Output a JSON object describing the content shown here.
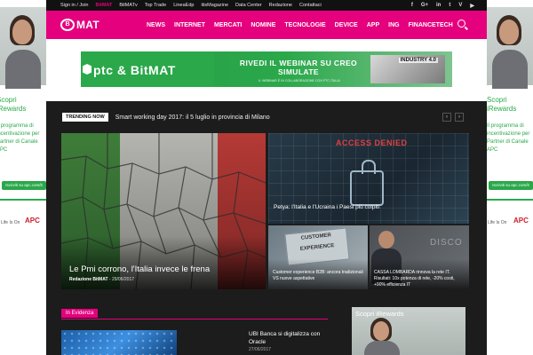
{
  "topbar": {
    "links": [
      "Sign in / Join",
      "BitMAT",
      "BitMATv",
      "Top Trade",
      "LineaEdp",
      "itisMagazine",
      "Data Center",
      "Redazione",
      "Contattaci"
    ],
    "social_icons": [
      "facebook-icon",
      "google-plus-icon",
      "linkedin-icon",
      "twitter-icon",
      "vimeo-icon",
      "youtube-icon"
    ],
    "social_glyphs": [
      "f",
      "G+",
      "in",
      "t",
      "V",
      "▶"
    ]
  },
  "nav": {
    "logo_badge": "B",
    "logo_text": "MAT",
    "items": [
      "NEWS",
      "INTERNET",
      "MERCATI",
      "NOMINE",
      "TECNOLOGIE",
      "DEVICE",
      "APP",
      "ING",
      "FINANCETECH"
    ]
  },
  "banner": {
    "brand": "ptc & BitMAT",
    "headline": "RIVEDI IL WEBINAR SU CREO SIMULATE",
    "sub": "IL WEBINAR È IN COLLABORAZIONE CON PTC ITALIA",
    "industry": "INDUSTRY 4.0"
  },
  "skins": {
    "title": "Scopri iRewards",
    "desc": "Il programma di incentivazione per Partner di Canale APC",
    "cta": "Iscriviti su apc.com/it",
    "strap": "Life Is On",
    "brand": "APC"
  },
  "trending": {
    "tag": "TRENDING NOW",
    "headline": "Smart working day 2017: il 5 luglio in provincia di Milano",
    "prev": "‹",
    "next": "›"
  },
  "hero": {
    "main": {
      "title": "Le Pmi corrono, l'Italia invece le frena",
      "author": "Redazione BitMAT",
      "date": "29/06/2017"
    },
    "security": {
      "banner": "ACCESS DENIED",
      "title": "Petya: l'Italia e l'Ucraina i Paesi più colpiti"
    },
    "customer": {
      "label": "CUSTOMER EXPERIENCE",
      "title": "Customer experience B2B: ancora tradizionali VS nuove aspettative"
    },
    "apc": {
      "label": "DISCO",
      "title": "CASSA LOMBARDA rinnova la rete IT. Risultati: 10x potenza di rete, -20% costi, +90% efficienza IT"
    }
  },
  "evidenza": {
    "label": "In Evidenza",
    "title": "UBI Banca si digitalizza con Oracle",
    "date": "27/06/2017"
  },
  "side_ad": {
    "title": "Scopri iRewards"
  }
}
